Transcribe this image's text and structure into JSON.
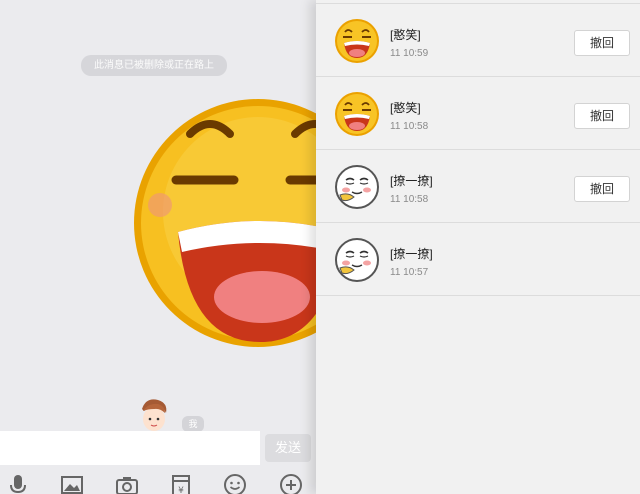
{
  "chat": {
    "system_notice": "此消息已被删除或正在路上",
    "tag": "我",
    "send_label": "发送",
    "input_value": ""
  },
  "toolbar": {
    "icons": [
      "microphone-icon",
      "image-icon",
      "camera-icon",
      "red-packet-icon",
      "emoji-icon",
      "plus-icon"
    ]
  },
  "recall_list": {
    "items": [
      {
        "name": "[憨笑]",
        "time": "11 10:59",
        "action": "撤回",
        "icon": "laughing-face-icon"
      },
      {
        "name": "[憨笑]",
        "time": "11 10:58",
        "action": "撤回",
        "icon": "laughing-face-icon"
      },
      {
        "name": "[撩一撩]",
        "time": "11 10:58",
        "action": "撤回",
        "icon": "flirt-face-icon"
      },
      {
        "name": "[撩一撩]",
        "time": "11 10:57",
        "action": "",
        "icon": "flirt-face-icon"
      }
    ]
  },
  "colors": {
    "emoji_yellow": "#f7b400",
    "mouth_red": "#d0391a",
    "panel_bg": "#f1f1f1",
    "chat_bg": "#ebebee"
  }
}
